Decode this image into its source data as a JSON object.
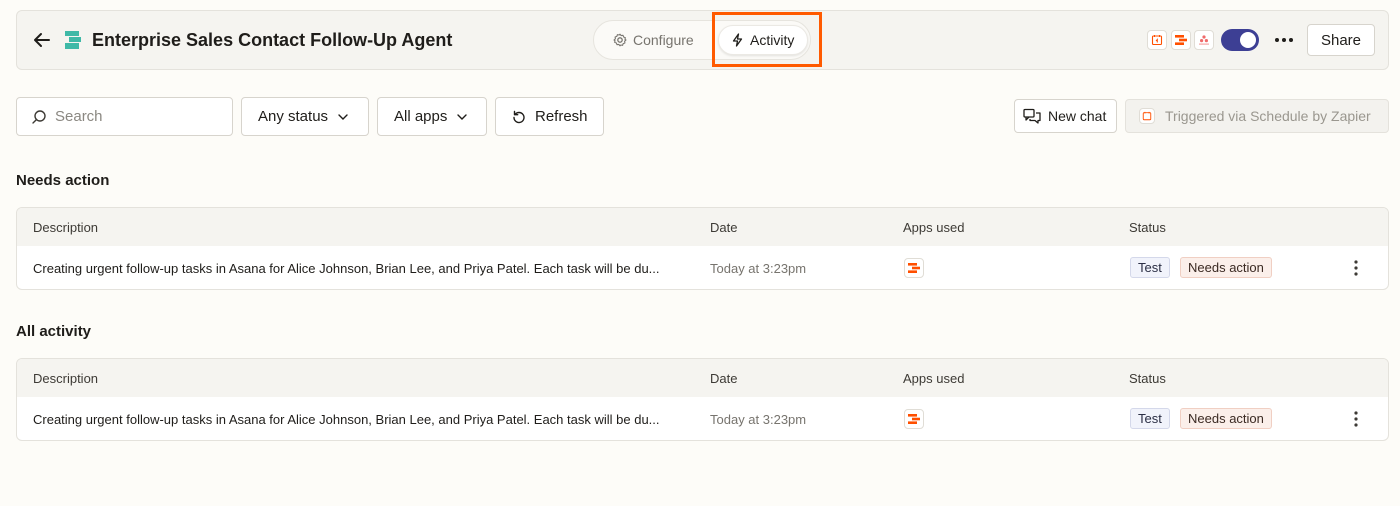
{
  "header": {
    "title": "Enterprise Sales Contact Follow-Up Agent",
    "back_icon": "arrow-left-icon",
    "logo_icon": "agent-logo-icon",
    "tabs": [
      {
        "label": "Configure",
        "icon": "gear-icon",
        "active": false
      },
      {
        "label": "Activity",
        "icon": "lightning-icon",
        "active": true
      }
    ],
    "app_icons": [
      "schedule-icon",
      "zapier-tables-icon",
      "asana-icon"
    ],
    "toggle_on": true,
    "share_label": "Share"
  },
  "filters": {
    "search_placeholder": "Search",
    "status_label": "Any status",
    "apps_label": "All apps",
    "refresh_label": "Refresh",
    "new_chat_label": "New chat",
    "trigger_label": "Triggered via Schedule by Zapier"
  },
  "sections": [
    {
      "title": "Needs action",
      "columns": [
        "Description",
        "Date",
        "Apps used",
        "Status"
      ],
      "rows": [
        {
          "description": "Creating urgent follow-up tasks in Asana for Alice Johnson, Brian Lee, and Priya Patel. Each task will be du...",
          "date": "Today at 3:23pm",
          "apps": [
            "zapier-tables-icon"
          ],
          "badges": [
            "Test",
            "Needs action"
          ]
        }
      ]
    },
    {
      "title": "All activity",
      "columns": [
        "Description",
        "Date",
        "Apps used",
        "Status"
      ],
      "rows": [
        {
          "description": "Creating urgent follow-up tasks in Asana for Alice Johnson, Brian Lee, and Priya Patel. Each task will be du...",
          "date": "Today at 3:23pm",
          "apps": [
            "zapier-tables-icon"
          ],
          "badges": [
            "Test",
            "Needs action"
          ]
        }
      ]
    }
  ],
  "colors": {
    "accent_toggle": "#3d3f94",
    "highlight": "#ff5a00",
    "brand_orange": "#ff4f00",
    "logo_teal": "#3fb9a7"
  }
}
